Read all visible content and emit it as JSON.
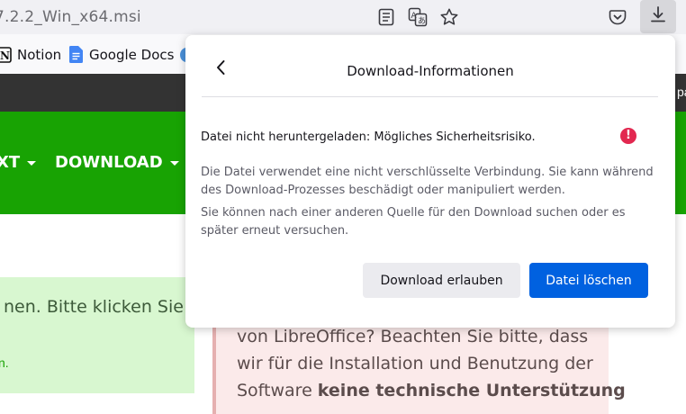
{
  "toolbar": {
    "url_text": "7.2.2_Win_x64.msi"
  },
  "bookmarks": {
    "items": [
      {
        "label": "Notion",
        "icon": "notion-icon"
      },
      {
        "label": "Google Docs",
        "icon": "google-docs-icon"
      }
    ]
  },
  "page": {
    "darkbar_text": "pa",
    "nav": {
      "item1": "XT",
      "item2": "DOWNLOAD"
    },
    "green_box": {
      "text": "nen. Bitte klicken Sie",
      "link": "n."
    },
    "pink_box": {
      "line1": "von LibreOffice? Beachten Sie bitte, dass",
      "line2": "wir für die Installation und Benutzung der",
      "line3_pre": "Software ",
      "line3_bold": "keine technische Unterstützung"
    }
  },
  "popup": {
    "title": "Download-Informationen",
    "heading": "Datei nicht heruntergeladen: Mögliches Sicherheitsrisiko.",
    "warn_glyph": "!",
    "paragraph1": "Die Datei verwendet eine nicht verschlüsselte Verbindung. Sie kann während des Download-Prozesses beschädigt oder manipuliert werden.",
    "paragraph2": "Sie können nach einer anderen Quelle für den Download suchen oder es später erneut versuchen.",
    "allow_button": "Download erlauben",
    "delete_button": "Datei löschen"
  }
}
